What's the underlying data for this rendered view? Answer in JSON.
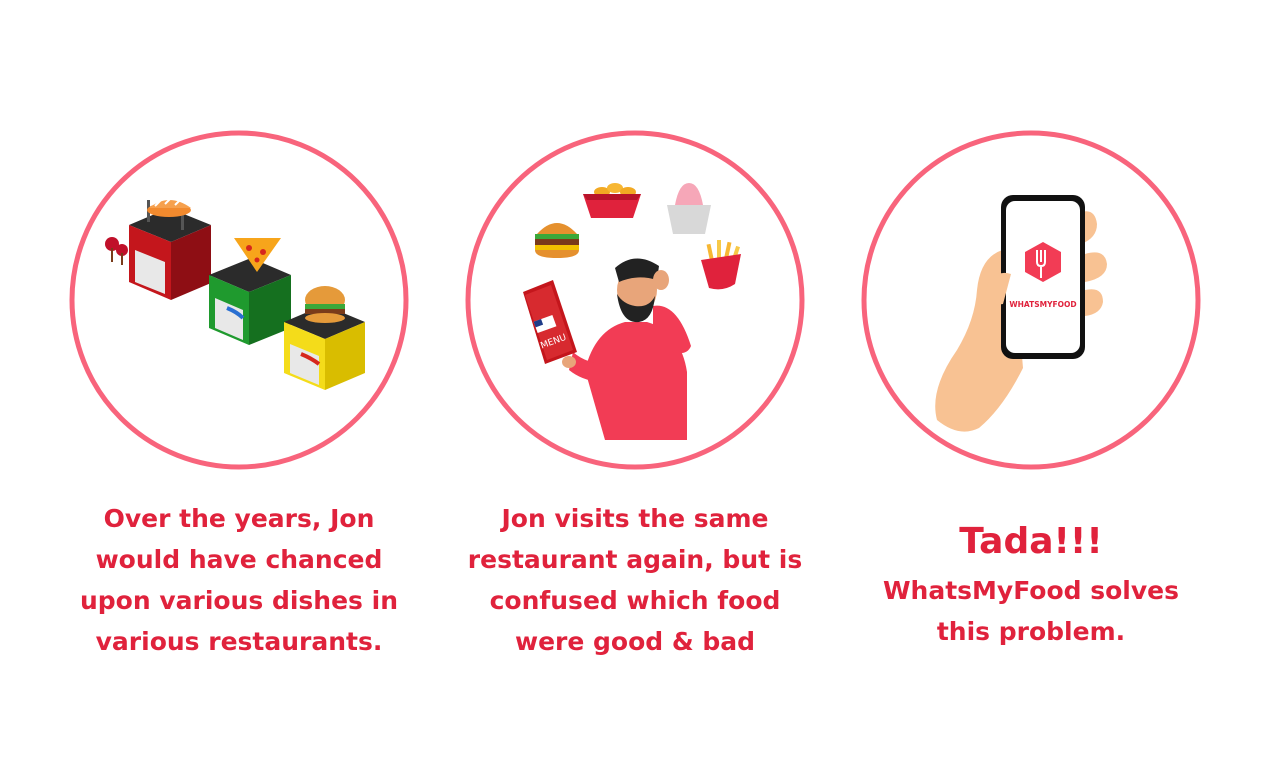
{
  "panels": [
    {
      "illustration": "restaurant-buildings",
      "caption_lines": [
        "Over the years, Jon",
        "would have chanced",
        "upon various dishes in",
        "various restaurants."
      ]
    },
    {
      "illustration": "man-reading-menu",
      "menu_label": "MENU",
      "caption_lines": [
        "Jon visits the same",
        "restaurant again, but is",
        "confused which food",
        "were good & bad"
      ]
    },
    {
      "illustration": "hand-holding-phone",
      "app_label": "WHATSMYFOOD",
      "title": "Tada!!!",
      "caption_lines": [
        "WhatsMyFood solves",
        "this problem."
      ]
    }
  ],
  "colors": {
    "circle_stroke": "#f8647c",
    "caption_text": "#e0223c",
    "accent_red": "#f23c55"
  }
}
